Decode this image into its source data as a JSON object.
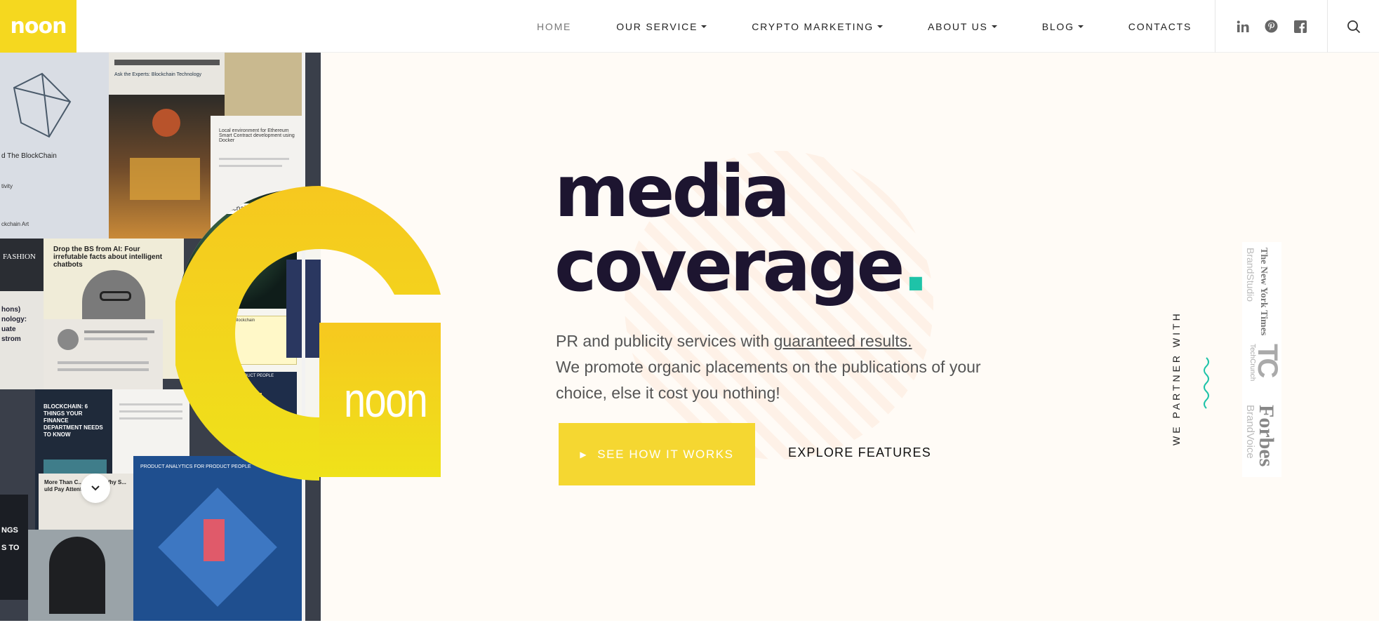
{
  "brand": {
    "logo_text": "noon"
  },
  "nav": {
    "items": [
      {
        "label": "HOME",
        "dropdown": false,
        "active": true
      },
      {
        "label": "OUR SERVICE",
        "dropdown": true,
        "active": false
      },
      {
        "label": "CRYPTO MARKETING",
        "dropdown": true,
        "active": false
      },
      {
        "label": "ABOUT US",
        "dropdown": true,
        "active": false
      },
      {
        "label": "BLOG",
        "dropdown": true,
        "active": false
      },
      {
        "label": "CONTACTS",
        "dropdown": false,
        "active": false
      }
    ]
  },
  "social": [
    "linkedin-icon",
    "pinterest-icon",
    "facebook-icon"
  ],
  "search_icon": "search-icon",
  "hero": {
    "headline_line1": "media",
    "headline_line2": "coverage",
    "headline_dot": ".",
    "sub_prefix": "PR and publicity services with ",
    "sub_link": "guaranteed results.",
    "sub_body": "We promote organic placements on the publications of your choice, else it cost you nothing!",
    "cta_primary": "SEE HOW IT WORKS",
    "cta_secondary": "EXPLORE FEATURES",
    "g_logo_text": "noon"
  },
  "partners": {
    "label": "WE PARTNER WITH",
    "logos": [
      {
        "name": "The New York Times",
        "sub": "BrandStudio"
      },
      {
        "name": "TC",
        "sub": "TechCrunch"
      },
      {
        "name": "Forbes",
        "sub": "BrandVoice"
      }
    ]
  },
  "collage_text": {
    "t1": "Ask the Experts: Blockchain Technology",
    "t2": "d The BlockChain",
    "t3": "Local environment for Ethereum Smart Contract development using Docker",
    "t4": "Drop the BS from AI: Four irrefutable facts about intelligent chatbots",
    "t5": "FASHION",
    "t6": "BLOCKCHAIN: 6 THINGS YOUR FINANCE DEPARTMENT NEEDS TO KNOW",
    "t7": "More Than C... pagne: Why S... uld Pay Attention to ...ks",
    "t8": "NGS",
    "t9": "S TO",
    "t10": "ANALYTICS FOR PRODUCT PEOPLE",
    "t11": "PRODUCT ANALYTICS FOR PRODUCT PEOPLE",
    "t12": "ckchain Art",
    "t13": "tivity",
    "t14": "hons)",
    "t15": "nology:",
    "t16": "uate",
    "t17": "strom",
    "t18": "ens Are ckchain",
    "t19": "Tracing Food Via Blockchain"
  },
  "colors": {
    "accent_yellow": "#f5d731",
    "teal": "#1ec3a8",
    "headline": "#1d1530",
    "hero_bg": "#fffbf6"
  }
}
